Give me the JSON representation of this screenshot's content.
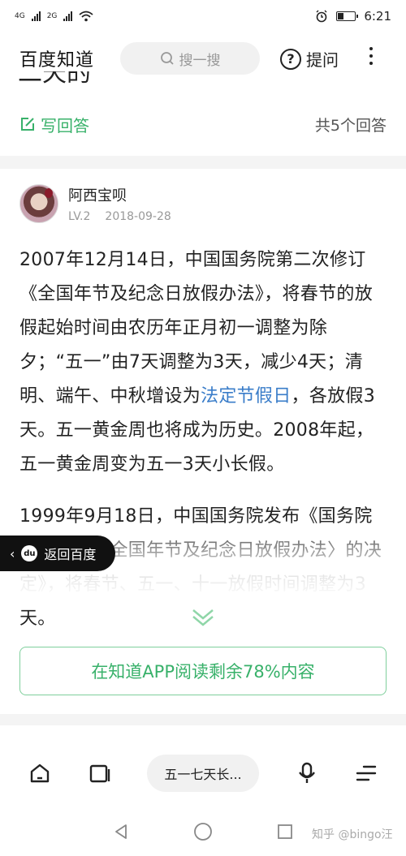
{
  "status_bar": {
    "signal1": "4G",
    "signal2": "2G",
    "time": "6:21"
  },
  "header": {
    "app_name": "百度知道",
    "search_placeholder": "搜一搜",
    "ask_label": "提问"
  },
  "question": {
    "title_fragment": "二天的"
  },
  "answer_bar": {
    "write_label": "写回答",
    "count_label": "共5个回答"
  },
  "answer": {
    "author": "阿西宝呗",
    "level": "LV.2",
    "date": "2018-09-28",
    "para1_a": "2007年12月14日，中国国务院第二次修订《全国年节及纪念日放假办法》，将春节的放假起始时间由农历年正月初一调整为除夕；“五一”由7天调整为3天，减少4天；清明、端午、中秋增设为",
    "para1_link": "法定节假日",
    "para1_b": "，各放假3天。五一黄金周也将成为历史。2008年起，五一黄金周变为五一3天小长假。",
    "para2": "1999年9月18日，中国国务院发布《国务院关于修改〈全国年节及纪念日放假办法〉的决定》，将春节、五一、十一放假时间调整为3天。"
  },
  "back_pill": {
    "label": "返回百度"
  },
  "read_more": {
    "label": "在知道APP阅读剩余78%内容"
  },
  "bottom_nav": {
    "current_page": "五一七天长..."
  },
  "watermark": "知乎 @bingo汪",
  "colors": {
    "accent_green": "#38b16a",
    "link_blue": "#3a7dc9"
  }
}
